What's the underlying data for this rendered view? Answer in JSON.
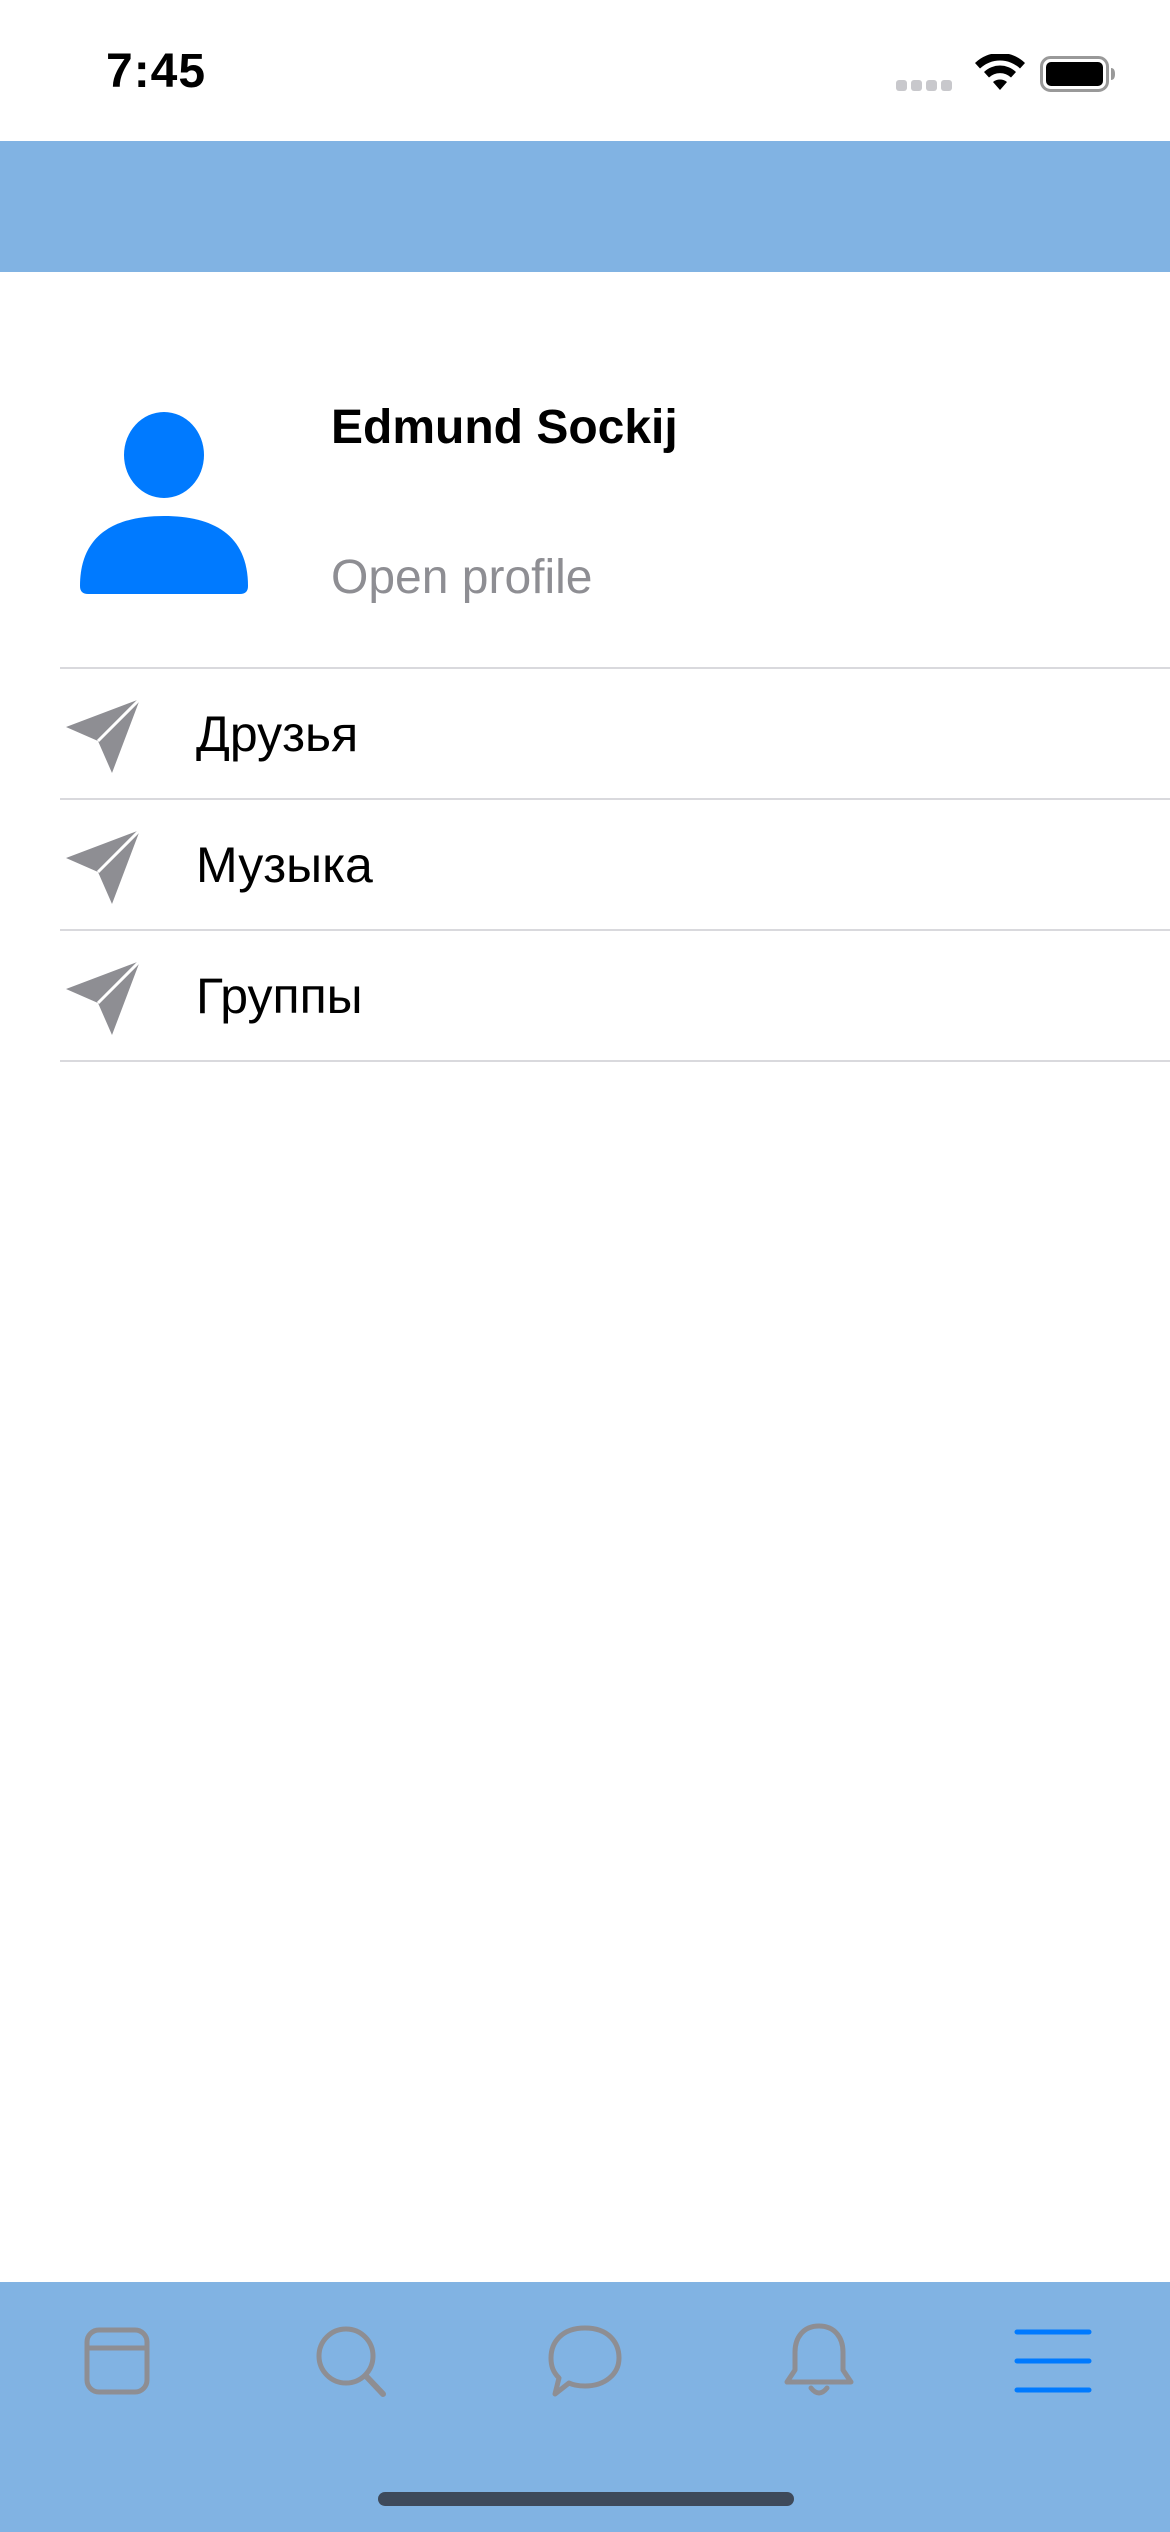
{
  "status_bar": {
    "time": "7:45",
    "icons": [
      "cellular-signal-icon",
      "wifi-icon",
      "battery-icon"
    ]
  },
  "profile": {
    "name": "Edmund Sockij",
    "open_profile_label": "Open profile",
    "avatar_icon": "person-icon"
  },
  "menu": {
    "items": [
      {
        "label": "Друзья",
        "icon": "send-icon"
      },
      {
        "label": "Музыка",
        "icon": "send-icon"
      },
      {
        "label": "Группы",
        "icon": "send-icon"
      }
    ]
  },
  "tab_bar": {
    "tabs": [
      {
        "icon": "feed-icon",
        "selected": false
      },
      {
        "icon": "search-icon",
        "selected": false
      },
      {
        "icon": "chat-bubble-icon",
        "selected": false
      },
      {
        "icon": "bell-icon",
        "selected": false
      },
      {
        "icon": "menu-icon",
        "selected": true
      }
    ]
  },
  "colors": {
    "bar_background": "#81b3e3",
    "accent": "#007aff",
    "icon_gray": "#8e8e93",
    "secondary_text": "#8e8e93",
    "divider": "#d9d9dd"
  }
}
